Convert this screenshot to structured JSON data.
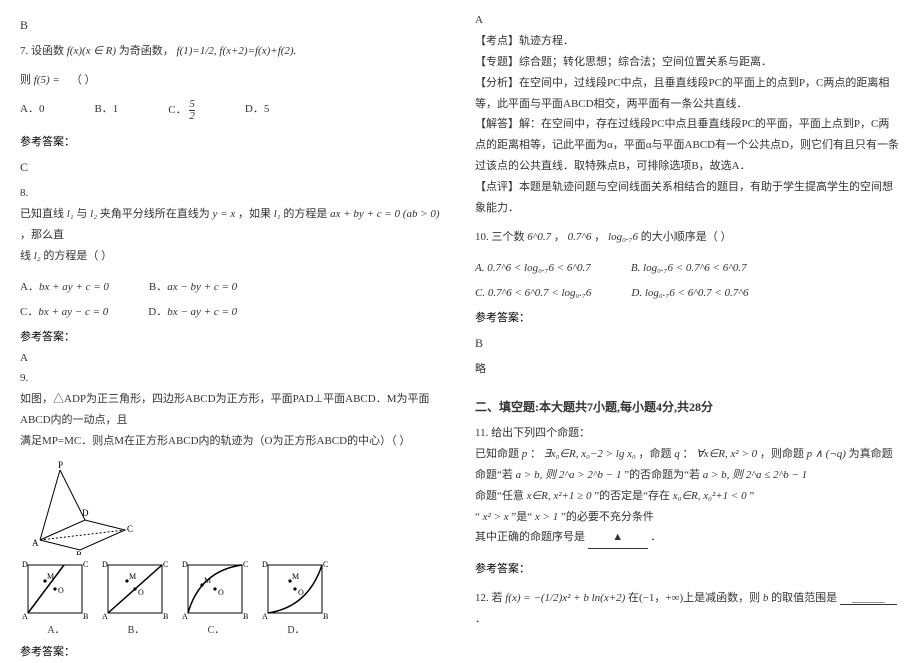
{
  "left": {
    "q7_ans_above": "B",
    "q7_stem_a": "7. 设函数",
    "q7_stem_b": "f(x)(x ∈ R)",
    "q7_stem_c": "为奇函数，",
    "q7_stem_d": "f(1)=1/2,  f(x+2)=f(x)+f(2).",
    "q7_then": "则",
    "q7_f5": "f(5) =",
    "q7_paren": "（        ）",
    "q7_optA": "A．0",
    "q7_optB": "B．1",
    "q7_optC": "C．",
    "q7_optC_val": "5/2",
    "q7_optD": "D．5",
    "ref_answer": "参考答案：",
    "q7_answer": "C",
    "q8_num": "8.",
    "q8_line1a": "已知直线",
    "q8_l1": "l₁",
    "q8_line1b": "与",
    "q8_l2": "l₂",
    "q8_line1c": "夹角平分线所在直线为",
    "q8_yx": "y = x",
    "q8_line1d": "，如果",
    "q8_line1e": "的方程是",
    "q8_eq1": "ax + by + c = 0 (ab > 0)",
    "q8_line1f": "，那么直",
    "q8_line2a": "线",
    "q8_line2b": "的方程是（      ）",
    "q8_optA": "A．",
    "q8_optA_eq": "bx + ay + c = 0",
    "q8_optB": "B．",
    "q8_optB_eq": "ax − by + c = 0",
    "q8_optC": "C．",
    "q8_optC_eq": "bx + ay − c = 0",
    "q8_optD": "D．",
    "q8_optD_eq": "bx − ay + c = 0",
    "q8_answer": "A",
    "q9_num": "9.",
    "q9_line1": "如图，△ADP为正三角形，四边形ABCD为正方形，平面PAD⊥平面ABCD．M为平面ABCD内的一动点，且",
    "q9_line2": "满足MP=MC．则点M在正方形ABCD内的轨迹为（O为正方形ABCD的中心）（      ）",
    "q9_labelA": "A．",
    "q9_labelB": "B．",
    "q9_labelC": "C．",
    "q9_labelD": "D．",
    "q9_P": "P",
    "q9_A": "A",
    "q9_B": "B",
    "q9_C": "C",
    "q9_D": "D",
    "q9_M": "M",
    "q9_O": "O"
  },
  "right": {
    "q9_answer": "A",
    "kaodian_label": "【考点】",
    "kaodian": "轨迹方程．",
    "zhuanti_label": "【专题】",
    "zhuanti": "综合题；转化思想；综合法；空间位置关系与距离．",
    "fenxi_label": "【分析】",
    "fenxi": "在空间中，过线段PC中点，且垂直线段PC的平面上的点到P，C两点的距离相等，此平面与平面ABCD相交，两平面有一条公共直线．",
    "jieda_label": "【解答】",
    "jieda": "解：在空间中，存在过线段PC中点且垂直线段PC的平面，平面上点到P，C两点的距离相等，记此平面为α，平面α与平面ABCD有一个公共点D，则它们有且只有一条过该点的公共直线．取特殊点B，可排除选项B，故选A．",
    "dianping_label": "【点评】",
    "dianping": "本题是轨迹问题与空间线面关系相结合的题目，有助于学生提高学生的空间想象能力．",
    "q10_stem_a": "10. 三个数",
    "q10_e1": "6^0.7",
    "q10_e2": "，",
    "q10_e3": "0.7^6",
    "q10_e4": "，",
    "q10_e5": "log₀.₇6",
    "q10_stem_b": "的大小顺序是（        ）",
    "q10_optA": "A. 0.7^6 < log₀.₇6 < 6^0.7",
    "q10_optB": "B. log₀.₇6 < 0.7^6 < 6^0.7",
    "q10_optC": "C. 0.7^6 < 6^0.7 < log₀.₇6",
    "q10_optD": "D. log₀.₇6 < 6^0.7 < 0.7^6",
    "ref_answer": "参考答案：",
    "q10_answer": "B",
    "q10_lve": "略",
    "section2": "二、填空题:本大题共7小题,每小题4分,共28分",
    "q11_stem": "11. 给出下列四个命题：",
    "q11_l1a": "已知命题",
    "q11_p": "p",
    "q11_l1b": "：",
    "q11_p_eq": "∃x₀∈R, x₀−2 > lg x₀",
    "q11_l1c": "，命题",
    "q11_q": "q",
    "q11_l1d": "：",
    "q11_q_eq": "∀x∈R, x² > 0",
    "q11_l1e": "，则命题",
    "q11_pnq": "p ∧ (¬q)",
    "q11_l1f": "为真命题",
    "q11_l2a": "命题“若",
    "q11_l2b": "a > b, 则 2^a > 2^b − 1",
    "q11_l2c": "”的否命题为“若",
    "q11_l2d": "a > b, 则 2^a ≤ 2^b − 1",
    "q11_l3a": "命题“任意",
    "q11_l3b": "x∈R, x²+1 ≥ 0",
    "q11_l3c": "”的否定是“存在",
    "q11_l3d": "x₀∈R, x₀²+1 < 0",
    "q11_l3e": "”",
    "q11_l4a": "“",
    "q11_l4b": "x² > x",
    "q11_l4c": "”是“",
    "q11_l4d": "x > 1",
    "q11_l4e": "”的必要不充分条件",
    "q11_l5": "其中正确的命题序号是",
    "q11_tri": "▲",
    "q11_dot": "．",
    "q12_a": "12. 若",
    "q12_eq": "f(x) = −(1/2)x² + b ln(x+2)",
    "q12_b": "在(−1，+∞)上是减函数，则",
    "q12_bvar": "b",
    "q12_c": "的取值范围是",
    "q12_blank": "______",
    "q12_d": "．"
  }
}
